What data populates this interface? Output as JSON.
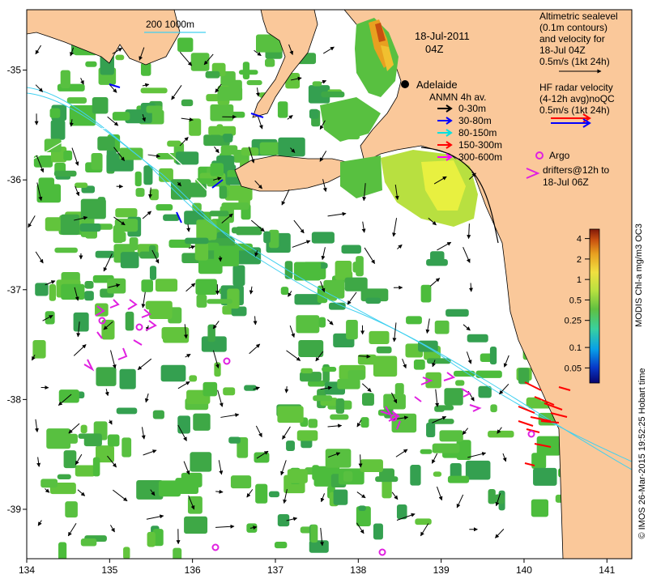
{
  "map": {
    "date": "18-Jul-2011",
    "time": "04Z",
    "city": "Adelaide",
    "scale_bar": {
      "label": "200  1000m"
    },
    "lon_ticks": [
      "134",
      "135",
      "136",
      "137",
      "138",
      "139",
      "140",
      "141"
    ],
    "lat_ticks": [
      "-35",
      "-36",
      "-37",
      "-38",
      "-39"
    ],
    "extent": {
      "lon": [
        134,
        141.3
      ],
      "lat": [
        -39.45,
        -34.45
      ]
    },
    "colors": {
      "land": "#fac89a",
      "ocean": "#ffffff",
      "chl_green": "#4cbc3c",
      "altimetry_arrow": "#000000",
      "argo": "#e020e0",
      "hf_red": "#ff0000",
      "hf_blue": "#0000ff",
      "isobath": "#40d0f0"
    }
  },
  "legend": {
    "altimetry": [
      "Altimetric sealevel",
      "(0.1m contours)",
      "and velocity for",
      "18-Jul 04Z",
      "0.5m/s (1kt 24h)"
    ],
    "hf_radar": [
      "HF radar velocity",
      "(4-12h avg)noQC",
      "0.5m/s (1kt 24h)"
    ],
    "anmn": {
      "title": "ANMN 4h av.",
      "items": [
        {
          "label": "0-30m",
          "color": "#000000"
        },
        {
          "label": "30-80m",
          "color": "#0000ff"
        },
        {
          "label": "80-150m",
          "color": "#00e0e0"
        },
        {
          "label": "150-300m",
          "color": "#ff0000"
        },
        {
          "label": "300-600m",
          "color": "#ff00ff"
        }
      ]
    },
    "argo": [
      "Argo"
    ],
    "drifters": [
      "drifters@12h to",
      "18-Jul 06Z"
    ]
  },
  "colorbar": {
    "title": "MODIS Chl-a mg/m3 OC3",
    "ticks": [
      {
        "label": "4",
        "value": 4
      },
      {
        "label": "2",
        "value": 2
      },
      {
        "label": "1",
        "value": 1
      },
      {
        "label": "0.5",
        "value": 0.5
      },
      {
        "label": "0.25",
        "value": 0.25
      },
      {
        "label": "0.1",
        "value": 0.1
      },
      {
        "label": "0.05",
        "value": 0.05
      }
    ],
    "scale": "log",
    "colors": [
      "#08046e",
      "#0838c8",
      "#08a0e8",
      "#38d0a0",
      "#60c040",
      "#b8e040",
      "#f0e040",
      "#e8a020",
      "#c85010",
      "#801808"
    ]
  },
  "credit": "© IMOS 26-Mar-2015 19:52:25 Hobart time"
}
